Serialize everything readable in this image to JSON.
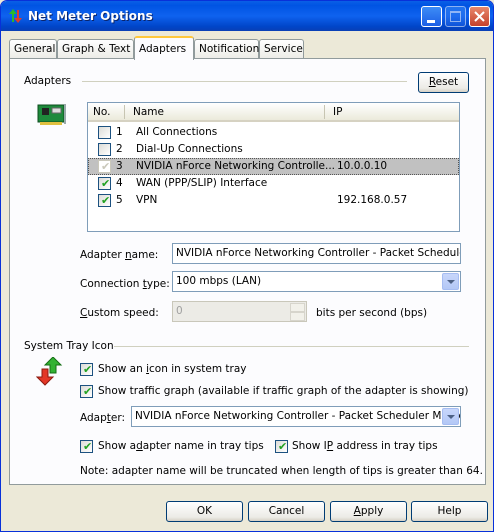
{
  "window": {
    "title": "Net Meter Options"
  },
  "tabs": [
    "General",
    "Graph & Text",
    "Adapters",
    "Notification",
    "Service"
  ],
  "active_tab": "Adapters",
  "adapters": {
    "section_label": "Adapters",
    "reset_label": "Reset",
    "columns": [
      "No.",
      "Name",
      "IP"
    ],
    "rows": [
      {
        "no": "1",
        "name": "All Connections",
        "ip": "",
        "checked": false,
        "disabled": false,
        "selected": false
      },
      {
        "no": "2",
        "name": "Dial-Up Connections",
        "ip": "",
        "checked": false,
        "disabled": false,
        "selected": false
      },
      {
        "no": "3",
        "name": "NVIDIA nForce Networking Controlle...",
        "ip": "10.0.0.10",
        "checked": true,
        "disabled": true,
        "selected": true
      },
      {
        "no": "4",
        "name": "WAN (PPP/SLIP) Interface",
        "ip": "",
        "checked": true,
        "disabled": false,
        "selected": false
      },
      {
        "no": "5",
        "name": "VPN",
        "ip": "192.168.0.57",
        "checked": true,
        "disabled": false,
        "selected": false
      }
    ],
    "adapter_name_label": "Adapter name:",
    "adapter_name_value": "NVIDIA nForce Networking Controller - Packet Scheduler Mi",
    "connection_type_label": "Connection type:",
    "connection_type_value": "100 mbps (LAN)",
    "custom_speed_label": "Custom speed:",
    "custom_speed_value": "0",
    "custom_speed_unit": "bits per second (bps)"
  },
  "tray": {
    "section_label": "System Tray Icon",
    "show_icon_label": "Show an icon in system tray",
    "show_icon_checked": true,
    "show_graph_label": "Show traffic graph (available if traffic graph of the adapter is showing)",
    "show_graph_checked": true,
    "adapter_label": "Adapter:",
    "adapter_value": "NVIDIA nForce Networking Controller - Packet Scheduler Minipor",
    "show_name_label": "Show adapter name in tray tips",
    "show_name_checked": true,
    "show_ip_label": "Show IP address in tray tips",
    "show_ip_checked": true,
    "note": "Note: adapter name will be truncated when length of tips is greater than 64."
  },
  "buttons": {
    "ok": "OK",
    "cancel": "Cancel",
    "apply": "Apply",
    "help": "Help"
  }
}
